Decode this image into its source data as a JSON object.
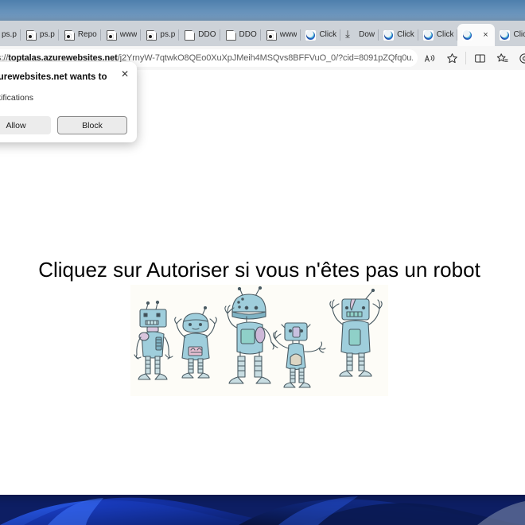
{
  "window": {
    "browser": "Microsoft Edge"
  },
  "tabs": {
    "items": [
      {
        "label": "ps.p",
        "icon": "pdf-document-icon"
      },
      {
        "label": "ps.p",
        "icon": "pdf-document-icon"
      },
      {
        "label": "Repo",
        "icon": "pdf-document-icon"
      },
      {
        "label": "www",
        "icon": "pdf-document-icon"
      },
      {
        "label": "ps.p",
        "icon": "pdf-document-icon"
      },
      {
        "label": "DDO",
        "icon": "document-icon"
      },
      {
        "label": "DDO",
        "icon": "document-icon"
      },
      {
        "label": "www",
        "icon": "pdf-document-icon"
      },
      {
        "label": "Click",
        "icon": "edge-icon"
      },
      {
        "label": "Dow",
        "icon": "download-icon"
      },
      {
        "label": "Click",
        "icon": "edge-icon"
      },
      {
        "label": "Click",
        "icon": "edge-icon"
      },
      {
        "label": "",
        "icon": "edge-icon",
        "active": true,
        "close_label": "×"
      },
      {
        "label": "Click",
        "icon": "edge-icon"
      }
    ],
    "new_tab_label": "+"
  },
  "toolbar": {
    "url_prefix": "ps://",
    "url_domain": "toptalas.azurewebsites.net",
    "url_path": "/j2YrnyW-7qtwkO8QEo0XuXpJMeih4MSQvs8BFFVuO_0/?cid=8091pZQfq0u...",
    "icons": [
      {
        "name": "read-aloud-icon",
        "glyph": "Aᴺ"
      },
      {
        "name": "favorite-star-icon",
        "glyph": "☆"
      },
      {
        "name": "split-screen-icon",
        "glyph": "⬚"
      },
      {
        "name": "collections-icon",
        "glyph": "☆"
      },
      {
        "name": "browser-essentials-icon",
        "glyph": "◔"
      }
    ]
  },
  "permission_dialog": {
    "title": "s.azurewebsites.net wants to",
    "subtitle": "w notifications",
    "close_label": "✕",
    "allow_label": "Allow",
    "block_label": "Block"
  },
  "page": {
    "heading": "Cliquez sur Autoriser si vous n'êtes pas un robot",
    "image_alt": "five-cartoon-robots-illustration",
    "background": "#ffffff"
  },
  "colors": {
    "accent": "#0f3578",
    "desktop_top": "#6a93bb",
    "desktop_bottom": "#0b1f6b",
    "tabstrip": "#cdd2d8",
    "toolbar": "#f6f6f6"
  }
}
